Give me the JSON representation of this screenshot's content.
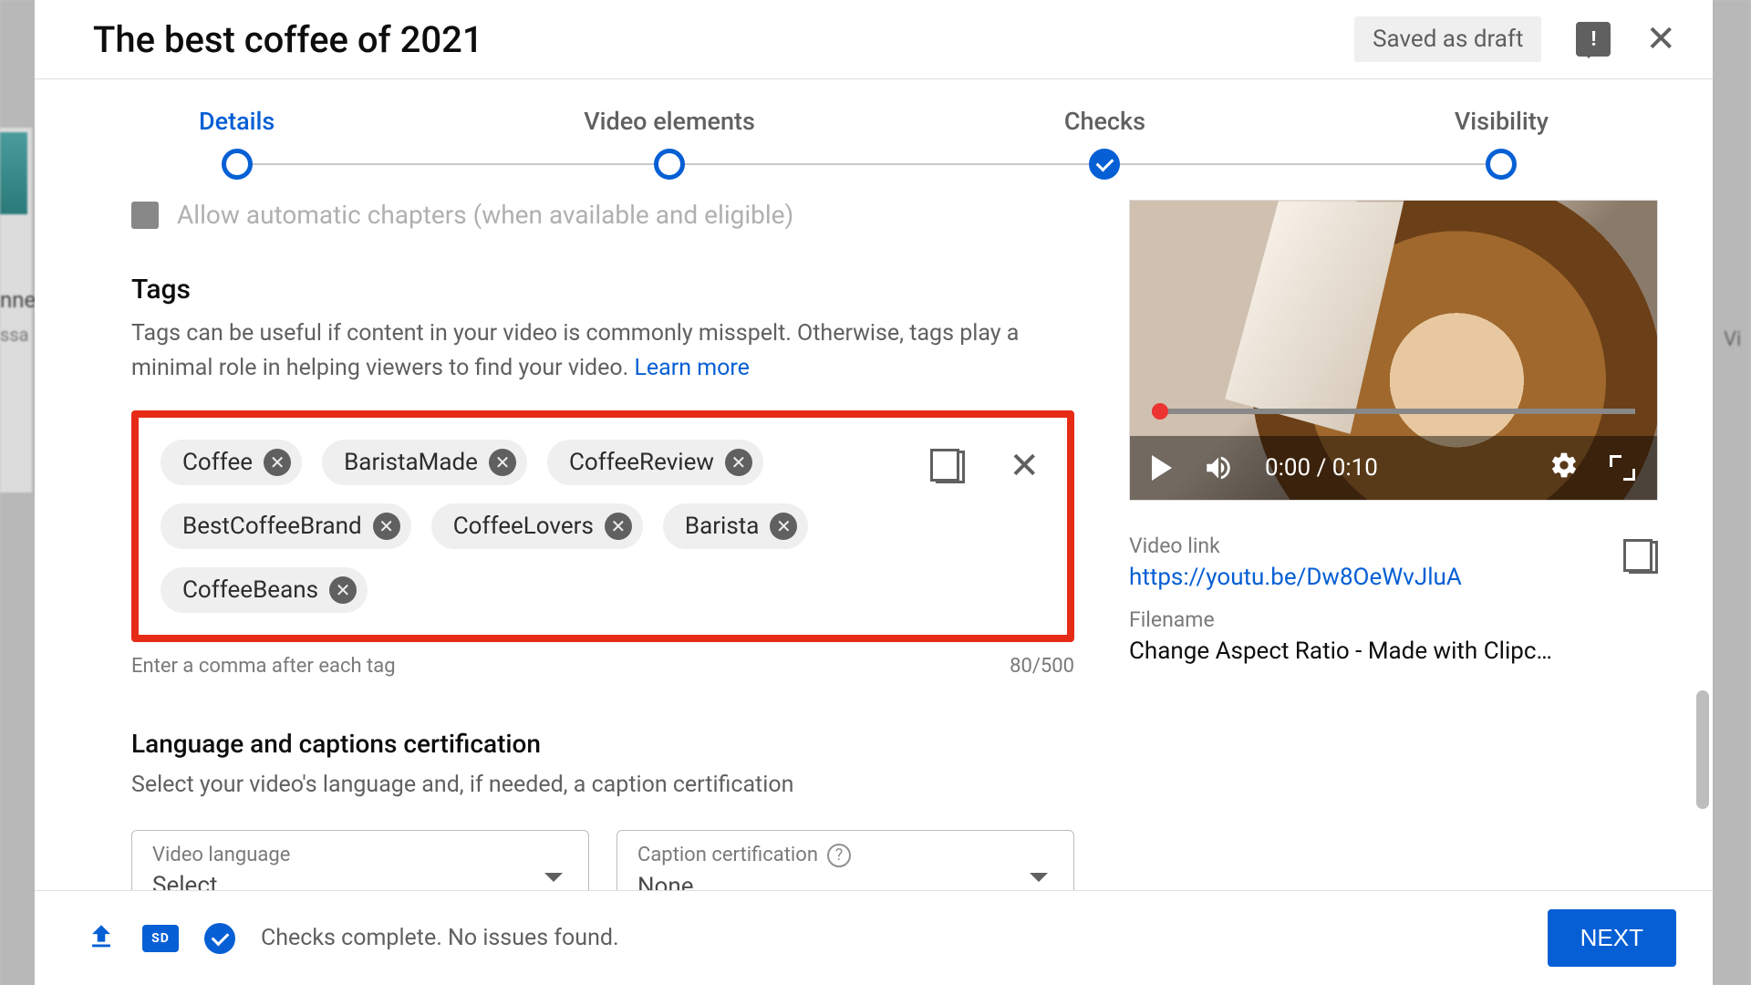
{
  "header": {
    "title": "The best coffee of 2021",
    "saved_badge": "Saved as draft"
  },
  "stepper": {
    "steps": [
      {
        "label": "Details",
        "active": true,
        "done": false
      },
      {
        "label": "Video elements",
        "active": false,
        "done": false
      },
      {
        "label": "Checks",
        "active": false,
        "done": true
      },
      {
        "label": "Visibility",
        "active": false,
        "done": false
      }
    ]
  },
  "cutoff_row": "Allow automatic chapters (when available and eligible)",
  "tags_section": {
    "heading": "Tags",
    "description": "Tags can be useful if content in your video is commonly misspelt. Otherwise, tags play a minimal role in helping viewers to find your video. ",
    "learn_more": "Learn more",
    "tags": [
      "Coffee",
      "BaristaMade",
      "CoffeeReview",
      "BestCoffeeBrand",
      "CoffeeLovers",
      "Barista",
      "CoffeeBeans"
    ],
    "hint": "Enter a comma after each tag",
    "counter": "80/500"
  },
  "lang_section": {
    "heading": "Language and captions certification",
    "description": "Select your video's language and, if needed, a caption certification",
    "video_language_label": "Video language",
    "video_language_value": "Select",
    "caption_label": "Caption certification",
    "caption_value": "None"
  },
  "preview": {
    "time": "0:00 / 0:10",
    "link_label": "Video link",
    "link": "https://youtu.be/Dw8OeWvJluA",
    "filename_label": "Filename",
    "filename": "Change Aspect Ratio - Made with Clipc…"
  },
  "footer": {
    "sd_badge": "SD",
    "status": "Checks complete. No issues found.",
    "next": "NEXT"
  }
}
